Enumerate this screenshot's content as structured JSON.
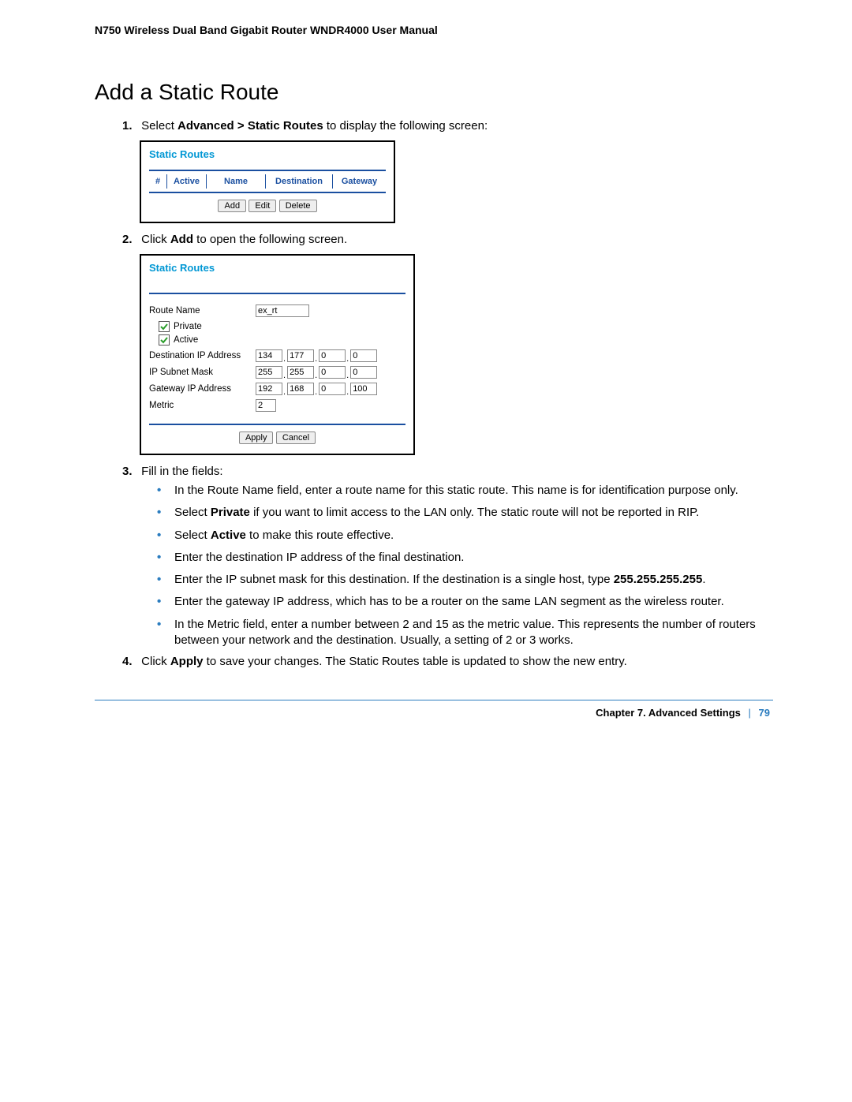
{
  "doc_header": "N750 Wireless Dual Band Gigabit Router WNDR4000 User Manual",
  "title": "Add a Static Route",
  "steps": {
    "s1": {
      "num": "1.",
      "pre": "Select ",
      "bold": "Advanced > Static Routes",
      "post": " to display the following screen:"
    },
    "s2": {
      "num": "2.",
      "pre": "Click ",
      "bold": "Add",
      "post": " to open the following screen."
    },
    "s3": {
      "num": "3.",
      "text": "Fill in the fields:"
    },
    "s4": {
      "num": "4.",
      "pre": "Click ",
      "bold": "Apply",
      "post": " to save your changes. The Static Routes table is updated to show the new entry."
    }
  },
  "bullets": {
    "b1": "In the Route Name field, enter a route name for this static route. This name is for identification purpose only.",
    "b2": {
      "pre": "Select ",
      "bold": "Private",
      "post": " if you want to limit access to the LAN only. The static route will not be reported in RIP."
    },
    "b3": {
      "pre": "Select ",
      "bold": "Active",
      "post": " to make this route effective."
    },
    "b4": "Enter the destination IP address of the final destination.",
    "b5": {
      "pre": "Enter the IP subnet mask for this destination. If the destination is a single host, type ",
      "bold": "255.255.255.255",
      "post": "."
    },
    "b6": "Enter the gateway IP address, which has to be a router on the same LAN segment as the wireless router.",
    "b7": "In the Metric field, enter a number between 2 and 15 as the metric value. This represents the number of routers between your network and the destination. Usually, a setting of 2 or 3 works."
  },
  "panel1": {
    "title": "Static Routes",
    "cols": {
      "c1": "#",
      "c2": "Active",
      "c3": "Name",
      "c4": "Destination",
      "c5": "Gateway"
    },
    "buttons": {
      "add": "Add",
      "edit": "Edit",
      "del": "Delete"
    }
  },
  "panel2": {
    "title": "Static Routes",
    "labels": {
      "route_name": "Route Name",
      "private": "Private",
      "active": "Active",
      "dest": "Destination IP Address",
      "mask": "IP Subnet Mask",
      "gw": "Gateway IP Address",
      "metric": "Metric"
    },
    "values": {
      "route_name": "ex_rt",
      "dest": [
        "134",
        "177",
        "0",
        "0"
      ],
      "mask": [
        "255",
        "255",
        "0",
        "0"
      ],
      "gw": [
        "192",
        "168",
        "0",
        "100"
      ],
      "metric": "2"
    },
    "buttons": {
      "apply": "Apply",
      "cancel": "Cancel"
    }
  },
  "footer": {
    "chapter": "Chapter 7.  Advanced Settings",
    "sep": "|",
    "page": "79"
  }
}
